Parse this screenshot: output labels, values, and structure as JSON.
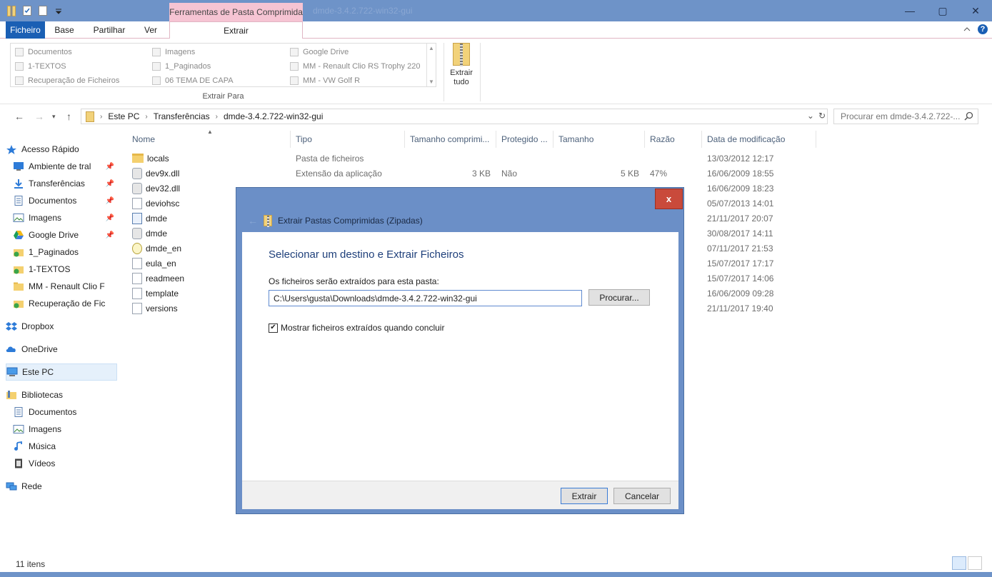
{
  "titlebar": {
    "context_tab": "Ferramentas de Pasta Comprimida",
    "title": "dmde-3.4.2.722-win32-gui",
    "minimize": "—",
    "maximize": "▢",
    "close": "✕"
  },
  "tabs": {
    "file": "Ficheiro",
    "home": "Base",
    "share": "Partilhar",
    "view": "Ver",
    "extract": "Extrair"
  },
  "ribbon": {
    "gallery": [
      [
        "Documentos",
        "1-TEXTOS",
        "Recuperação de Ficheiros"
      ],
      [
        "Imagens",
        "1_Paginados",
        "06 TEMA DE CAPA"
      ],
      [
        "Google Drive",
        "MM - Renault Clio RS Trophy 220",
        "MM - VW Golf R"
      ]
    ],
    "group_label": "Extrair Para",
    "extract_all_line1": "Extrair",
    "extract_all_line2": "tudo"
  },
  "address": {
    "segments": [
      "Este PC",
      "Transferências",
      "dmde-3.4.2.722-win32-gui"
    ],
    "search_placeholder": "Procurar em dmde-3.4.2.722-..."
  },
  "nav": {
    "quick_access": "Acesso Rápido",
    "items": [
      "Ambiente de tral",
      "Transferências",
      "Documentos",
      "Imagens",
      "Google Drive",
      "1_Paginados",
      "1-TEXTOS",
      "MM - Renault Clio F",
      "Recuperação de Fic"
    ],
    "dropbox": "Dropbox",
    "onedrive": "OneDrive",
    "this_pc": "Este PC",
    "libraries": "Bibliotecas",
    "lib_items": [
      "Documentos",
      "Imagens",
      "Música",
      "Vídeos"
    ],
    "network": "Rede"
  },
  "columns": [
    "Nome",
    "Tipo",
    "Tamanho comprimi...",
    "Protegido ...",
    "Tamanho",
    "Razão",
    "Data de modificação"
  ],
  "files": [
    {
      "name": "locals",
      "type": "Pasta de ficheiros",
      "csize": "",
      "prot": "",
      "size": "",
      "ratio": "",
      "date": "13/03/2012 12:17",
      "icon": "folder"
    },
    {
      "name": "dev9x.dll",
      "type": "Extensão da aplicação",
      "csize": "3 KB",
      "prot": "Não",
      "size": "5 KB",
      "ratio": "47%",
      "date": "16/06/2009 18:55",
      "icon": "gear"
    },
    {
      "name": "dev32.dll",
      "type": "",
      "csize": "",
      "prot": "",
      "size": "",
      "ratio": "",
      "date": "16/06/2009 18:23",
      "icon": "gear"
    },
    {
      "name": "deviohsc",
      "type": "",
      "csize": "",
      "prot": "",
      "size": "",
      "ratio": "",
      "date": "05/07/2013 14:01",
      "icon": "file"
    },
    {
      "name": "dmde",
      "type": "",
      "csize": "",
      "prot": "",
      "size": "",
      "ratio": "",
      "date": "21/11/2017 20:07",
      "icon": "exe"
    },
    {
      "name": "dmde",
      "type": "",
      "csize": "",
      "prot": "",
      "size": "",
      "ratio": "",
      "date": "30/08/2017 14:11",
      "icon": "gear"
    },
    {
      "name": "dmde_en",
      "type": "",
      "csize": "",
      "prot": "",
      "size": "",
      "ratio": "",
      "date": "07/11/2017 21:53",
      "icon": "help"
    },
    {
      "name": "eula_en",
      "type": "",
      "csize": "",
      "prot": "",
      "size": "",
      "ratio": "",
      "date": "15/07/2017 17:17",
      "icon": "file"
    },
    {
      "name": "readmeen",
      "type": "",
      "csize": "",
      "prot": "",
      "size": "",
      "ratio": "",
      "date": "15/07/2017 14:06",
      "icon": "file"
    },
    {
      "name": "template",
      "type": "",
      "csize": "",
      "prot": "",
      "size": "",
      "ratio": "",
      "date": "16/06/2009 09:28",
      "icon": "file"
    },
    {
      "name": "versions",
      "type": "",
      "csize": "",
      "prot": "",
      "size": "",
      "ratio": "",
      "date": "21/11/2017 19:40",
      "icon": "file"
    }
  ],
  "status": {
    "count": "11 itens"
  },
  "dialog": {
    "close": "x",
    "header": "Extrair Pastas Comprimidas (Zipadas)",
    "title": "Selecionar um destino e Extrair Ficheiros",
    "label": "Os ficheiros serão extraídos para esta pasta:",
    "path_value": "C:\\Users\\gusta\\Downloads\\dmde-3.4.2.722-win32-gui",
    "browse": "Procurar...",
    "checkbox_label": "Mostrar ficheiros extraídos quando concluir",
    "checkbox_checked": true,
    "extract": "Extrair",
    "cancel": "Cancelar"
  }
}
